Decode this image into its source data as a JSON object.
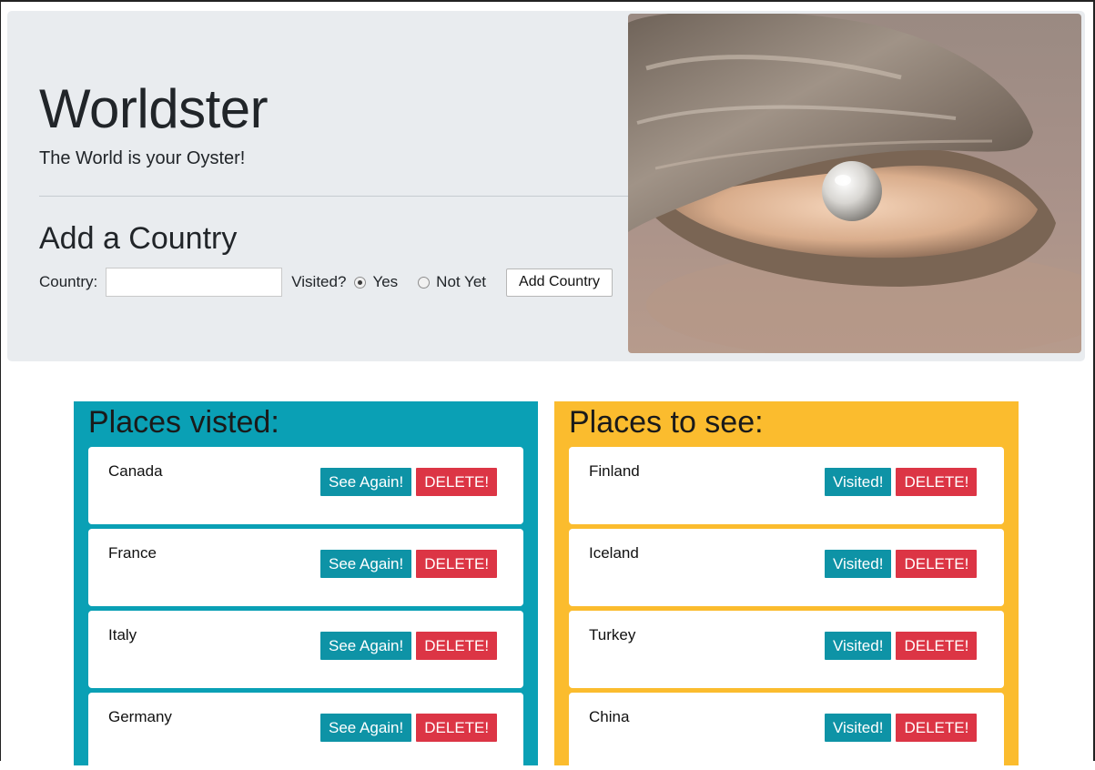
{
  "app": {
    "title": "Worldster",
    "tagline": "The World is your Oyster!"
  },
  "form": {
    "heading": "Add a Country",
    "country_label": "Country:",
    "country_value": "",
    "country_placeholder": "",
    "visited_label": "Visited?",
    "options": [
      {
        "label": "Yes",
        "checked": true
      },
      {
        "label": "Not Yet",
        "checked": false
      }
    ],
    "submit_label": "Add Country"
  },
  "image": {
    "icon": "oyster-pearl-photo"
  },
  "visited": {
    "title": "Places visted:",
    "action_label": "See Again!",
    "delete_label": "DELETE!",
    "items": [
      {
        "name": "Canada"
      },
      {
        "name": "France"
      },
      {
        "name": "Italy"
      },
      {
        "name": "Germany"
      }
    ]
  },
  "to_see": {
    "title": "Places to see:",
    "action_label": "Visited!",
    "delete_label": "DELETE!",
    "items": [
      {
        "name": "Finland"
      },
      {
        "name": "Iceland"
      },
      {
        "name": "Turkey"
      },
      {
        "name": "China"
      }
    ]
  },
  "colors": {
    "visited_panel": "#0aa0b5",
    "to_see_panel": "#fbbc2e",
    "info_button": "#0e93a6",
    "danger_button": "#dc3545",
    "jumbotron": "#e9ecef"
  }
}
